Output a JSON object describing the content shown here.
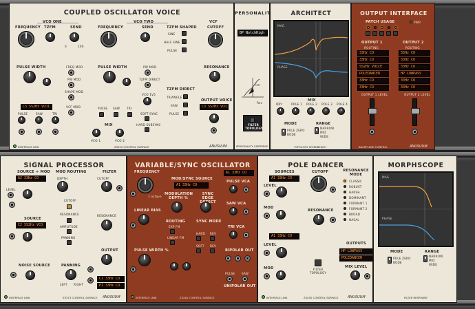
{
  "rack": {
    "brand": "ANUSUUM"
  },
  "coupled": {
    "title": "COUPLED OSCILLATOR VOICE",
    "vco_one": "VCO ONE",
    "vco_two": "VCO TWO",
    "vcf": "VCF",
    "frequency": "FREQUENCY",
    "tzfm": "TZFM",
    "send": "SEND",
    "frequency2": "FREQUENCY",
    "send2": "SEND",
    "tzfm_shaped": "TZFM SHAPED",
    "cutoff": "CUTOFF",
    "resonance": "RESONANCE",
    "output_voice": "OUTPUT VOICE",
    "pulse_width": "PULSE WIDTH",
    "pulse_width2": "PULSE WIDTH",
    "freq_mod": "FREQ MOD",
    "pw_mod": "PW MOD",
    "shape_mod": "SHAPE MOD",
    "vcf_mod": "VCF MOD",
    "pw_mod2": "PW MOD",
    "tzfm_direct_small": "TZFM DIRECT",
    "vco_1vs": "VCO 1V5",
    "sine": "SINE",
    "half_sine": "HALF SINE",
    "pulse_small": "PULSE",
    "tzfm_direct": "TZFM DIRECT",
    "triangle": "TRIANGLE",
    "saw": "SAW",
    "pulse3": "PULSE",
    "soft_sync": "SOFT SYNC",
    "hard_sync": "HARD SUBSYNC",
    "pulse": "PULSE",
    "saw1": "SAW",
    "tri": "TRI",
    "pulse2": "PULSE",
    "saw2": "SAW",
    "tri2": "TRI",
    "mix": "MIX",
    "vco1": "VCO 1",
    "vco2": "VCO 2",
    "disp1": "C3 SS2Hz  VCO1",
    "disp2": "C3 SS2Hz  VCO",
    "footer_left": "INTERFACE LINK",
    "footer_right": "Z3253 CONTROL SURFACE",
    "knob_scale_0": "0",
    "knob_scale_100": "100"
  },
  "personality": {
    "title": "PERSONALITY",
    "preset": "BP NotchHigh",
    "filter_topology": "FILTER TOPOLOGY",
    "footer": "PERSONALITY CARTRIDGE",
    "axis_lim": "lim",
    "axis_res": "Res"
  },
  "architect": {
    "title": "ARCHITECT",
    "mag": "MAG",
    "phase": "PHASE",
    "mix": "MIX",
    "knobs": [
      "DRY",
      "POLE 1",
      "POLE 2",
      "POLE 3",
      "POLE 4"
    ],
    "mode": "MODE",
    "range": "RANGE",
    "mode_opts": [
      "POLE ZERO",
      "BODE"
    ],
    "range_opts": [
      "NARROW",
      "MID",
      "WIDE"
    ],
    "footer": "TOPOLOGY WORKBENCH"
  },
  "output_interface": {
    "title": "OUTPUT INTERFACE",
    "patch_usage": "PATCH USAGE",
    "output1": "OUTPUT 1",
    "output2": "OUTPUT 2",
    "routing": "ROUTING",
    "out1_rows": [
      "33Hz  CO",
      "33Hz  CO",
      "SS2Hz VOICE",
      "POLEDANCER",
      "33Hz  CO",
      "33Hz  CO"
    ],
    "out2_rows": [
      "33Hz  CO",
      "33Hz  CO",
      "33Hz  CO",
      "HP LOWPASS",
      "33Hz  CO",
      "33Hz  CO"
    ],
    "level1": "OUTPUT 1 LEVEL",
    "level2": "OUTPUT 2 LEVEL",
    "footer": "BACKPLANE CONTROL",
    "pwr": "PWR"
  },
  "signal": {
    "title": "SIGNAL PROCESSOR",
    "source_mod": "SOURCE + MOD",
    "mod_routing": "MOD ROUTING",
    "filter": "FILTER",
    "disp_top": "A2 33Hz  CO",
    "depth": "DEPTH",
    "level": "LEVEL",
    "cutoff": "CUTOFF",
    "source": "SOURCE",
    "disp_src": "C2 SS2Hz VCO",
    "amplitude": "AMPLITUDE",
    "panning_small": "PANNING",
    "resonance": "RESONANCE",
    "output": "OUTPUT",
    "noise_source": "NOISE SOURCE",
    "panning": "PANNING",
    "left": "LEFT",
    "right": "RIGHT",
    "disp_l": "C1 33Hz  CO",
    "disp_r": "E1 33Hz  CO",
    "footer_left": "INTERFACE LINK",
    "footer_right": "Z3373 CONTROL SURFACE",
    "label_level": "LEVEL",
    "label_sig": "SIG"
  },
  "variable": {
    "title": "VARIABLE/SYNC OSCILLATOR",
    "frequency": "FREQUENCY",
    "mod_sync_source": "MOD/SYNC SOURCE",
    "disp_src": "A1 33Hz  CO",
    "modulation_depth": "MODULATION DEPTH %",
    "sync_edge": "SYNC EDGE DETECT",
    "linear_bias": "LINEAR BIAS",
    "routing": "ROUTING",
    "sync_mode": "SYNC MODE",
    "exp_fm": "EXP FM",
    "linear_fm": "LINEAR FM",
    "hard": "HARD",
    "rev": "REV",
    "soft": "SOFT",
    "rev2": "REV",
    "pulse_width": "PULSE WIDTH %",
    "disp_top": "A1 33Hz  CO",
    "pulse_vca": "PULSE VCA",
    "saw_vca": "SAW VCA",
    "tri_vca": "TRI VCA",
    "bipolar_out": "BIPOLAR OUT",
    "unipolar_out": "UNIPOLAR OUT",
    "pulse": "PULSE",
    "saw": "SAW",
    "tri": "TRI",
    "footer_left": "INTERFACE LINK",
    "footer_right": "Z3240 CONTROL SURFACE",
    "octave": "1 octave"
  },
  "pole": {
    "title": "POLE DANCER",
    "sources": "SOURCES",
    "disp_a": "A1 33Hz  CO",
    "disp_b": "A1 33Hz  CO",
    "level": "LEVEL",
    "mod": "MOD",
    "level2": "LEVEL",
    "mod2": "MOD",
    "cutoff": "CUTOFF",
    "resonance": "RESONANCE",
    "filter_topology": "FILTER TOPOLOGY",
    "resonance_mode": "RESONANCE MODE",
    "modes": [
      "CLASSIC",
      "ROBUST",
      "HARSH",
      "DOMINANT",
      "FORMANT 1",
      "FORMANT 2",
      "BROAD",
      "NASAL"
    ],
    "outputs": "OUTPUTS",
    "out_a": "HP LOWPASS",
    "out_b": "POLEDANCER",
    "mix_level": "MIX LEVEL",
    "disp_c": "A1 33Hz  CO",
    "disp_d": "A1 33Hz  CO",
    "footer_left": "INTERFACE LINK",
    "footer_right": "Z4430 CONTROL SURFACE"
  },
  "morph": {
    "title": "MORPHSCOPE",
    "mag": "MAG",
    "phase": "PHASE",
    "mode": "MODE",
    "range": "RANGE",
    "mode_opts": [
      "POLE ZERO",
      "BODE"
    ],
    "range_opts": [
      "NARROW",
      "MID",
      "WIDE"
    ],
    "footer": "FILTER RESPONSE"
  }
}
